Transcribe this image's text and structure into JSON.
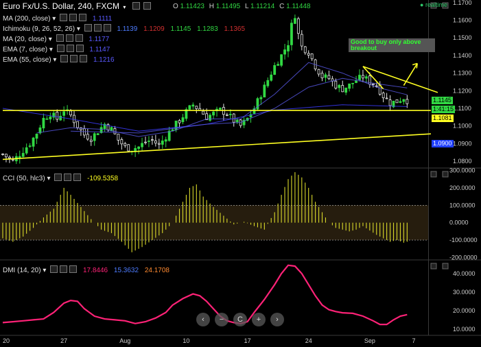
{
  "header": {
    "title": "Euro Fx/U.S. Dollar, 240, FXCM",
    "ohlc": [
      {
        "label": "O",
        "value": "1.11423"
      },
      {
        "label": "H",
        "value": "1.11495"
      },
      {
        "label": "L",
        "value": "1.11214"
      },
      {
        "label": "C",
        "value": "1.11448"
      }
    ],
    "realtime": "realtime"
  },
  "indicators": [
    {
      "name": "MA (200, close)",
      "values": [
        "1.1111"
      ],
      "colors": [
        "#5a5aff"
      ]
    },
    {
      "name": "Ichimoku (9, 26, 52, 26)",
      "values": [
        "1.1139",
        "1.1209",
        "1.1145",
        "1.1283",
        "1.1365"
      ],
      "colors": [
        "#4d7cff",
        "#d23030",
        "#31d843",
        "#31d843",
        "#d23030"
      ]
    },
    {
      "name": "MA (20, close)",
      "values": [
        "1.1177"
      ],
      "colors": [
        "#5a5aff"
      ]
    },
    {
      "name": "EMA (7, close)",
      "values": [
        "1.1147"
      ],
      "colors": [
        "#5a5aff"
      ]
    },
    {
      "name": "EMA (55, close)",
      "values": [
        "1.1216"
      ],
      "colors": [
        "#5a5aff"
      ]
    }
  ],
  "annotation": "Good to buy only above breakout",
  "price_labels": [
    {
      "text": "1.1145",
      "bg": "#31d843",
      "fg": "#000"
    },
    {
      "text": "1:41:15",
      "bg": "#31d843",
      "fg": "#000"
    },
    {
      "text": "1.1081",
      "bg": "#ffff22",
      "fg": "#000"
    },
    {
      "text": "1.0900",
      "bg": "#2040ff",
      "fg": "#fff"
    }
  ],
  "cci_panel": {
    "name": "CCI (50, hlc3)",
    "value": "-109.5358",
    "value_color": "#ffff22"
  },
  "dmi_panel": {
    "name": "DMI (14, 20)",
    "values": [
      "17.8446",
      "15.3632",
      "24.1708"
    ],
    "colors": [
      "#ff2277",
      "#4d7cff",
      "#ff8a30"
    ]
  },
  "controls": [
    "‹",
    "−",
    "C",
    "+",
    "›"
  ],
  "colors": {
    "bull": "#31d843",
    "bear": "#e8e8e8",
    "trend": "#ffff22",
    "ma": "#4a4aff",
    "cci": "#d9d92a",
    "dmi": "#ff2277"
  },
  "chart_data": [
    {
      "type": "candlestick",
      "title": "Euro Fx/U.S. Dollar, 240, FXCM",
      "x_ticks": [
        "20",
        "27",
        "Aug",
        "10",
        "17",
        "24",
        "Sep",
        "7"
      ],
      "y_ticks": [
        "1.1700",
        "1.1600",
        "1.1500",
        "1.1400",
        "1.1300",
        "1.1200",
        "1.1100",
        "1.1000",
        "1.0900",
        "1.0800"
      ],
      "ylim": [
        1.0765,
        1.1715
      ],
      "close_path": [
        [
          0,
          1.084
        ],
        [
          3,
          1.08
        ],
        [
          6,
          1.086
        ],
        [
          8,
          1.09
        ],
        [
          10,
          1.096
        ],
        [
          12,
          1.104
        ],
        [
          14,
          1.107
        ],
        [
          16,
          1.104
        ],
        [
          18,
          1.109
        ],
        [
          20,
          1.106
        ],
        [
          22,
          1.1
        ],
        [
          24,
          1.095
        ],
        [
          26,
          1.093
        ],
        [
          28,
          1.097
        ],
        [
          30,
          1.101
        ],
        [
          32,
          1.098
        ],
        [
          34,
          1.092
        ],
        [
          36,
          1.088
        ],
        [
          38,
          1.087
        ],
        [
          40,
          1.088
        ],
        [
          42,
          1.091
        ],
        [
          44,
          1.092
        ],
        [
          46,
          1.089
        ],
        [
          48,
          1.094
        ],
        [
          50,
          1.099
        ],
        [
          52,
          1.103
        ],
        [
          54,
          1.108
        ],
        [
          56,
          1.112
        ],
        [
          58,
          1.109
        ],
        [
          60,
          1.105
        ],
        [
          62,
          1.107
        ],
        [
          64,
          1.109
        ],
        [
          66,
          1.107
        ],
        [
          68,
          1.103
        ],
        [
          70,
          1.1
        ],
        [
          72,
          1.104
        ],
        [
          74,
          1.11
        ],
        [
          76,
          1.118
        ],
        [
          78,
          1.126
        ],
        [
          80,
          1.134
        ],
        [
          82,
          1.14
        ],
        [
          84,
          1.147
        ],
        [
          85,
          1.157
        ],
        [
          86,
          1.163
        ],
        [
          87,
          1.152
        ],
        [
          88,
          1.145
        ],
        [
          90,
          1.142
        ],
        [
          92,
          1.134
        ],
        [
          94,
          1.128
        ],
        [
          96,
          1.127
        ],
        [
          98,
          1.123
        ],
        [
          100,
          1.121
        ],
        [
          102,
          1.123
        ],
        [
          104,
          1.126
        ],
        [
          106,
          1.128
        ],
        [
          108,
          1.125
        ],
        [
          110,
          1.123
        ],
        [
          112,
          1.117
        ],
        [
          114,
          1.113
        ],
        [
          116,
          1.114
        ],
        [
          118,
          1.116
        ],
        [
          119,
          1.1145
        ]
      ],
      "series": [
        {
          "name": "MA (200, close)",
          "values": [
            [
              0,
              1.11
            ],
            [
              20,
              1.104
            ],
            [
              40,
              1.097
            ],
            [
              60,
              1.101
            ],
            [
              80,
              1.109
            ],
            [
              100,
              1.112
            ],
            [
              119,
              1.111
            ]
          ]
        },
        {
          "name": "MA (20, close)",
          "values": [
            [
              10,
              1.096
            ],
            [
              20,
              1.099
            ],
            [
              30,
              1.098
            ],
            [
              40,
              1.094
            ],
            [
              50,
              1.097
            ],
            [
              60,
              1.104
            ],
            [
              70,
              1.104
            ],
            [
              80,
              1.118
            ],
            [
              90,
              1.136
            ],
            [
              100,
              1.13
            ],
            [
              110,
              1.122
            ],
            [
              119,
              1.1177
            ]
          ]
        },
        {
          "name": "EMA (55, close)",
          "values": [
            [
              20,
              1.097
            ],
            [
              40,
              1.096
            ],
            [
              60,
              1.101
            ],
            [
              70,
              1.102
            ],
            [
              80,
              1.11
            ],
            [
              90,
              1.122
            ],
            [
              100,
              1.127
            ],
            [
              110,
              1.124
            ],
            [
              119,
              1.1216
            ]
          ]
        }
      ],
      "trendlines": [
        {
          "from": [
            0,
            1.081
          ],
          "to": [
            126,
            1.0955
          ]
        },
        {
          "from": [
            0,
            1.1088
          ],
          "to": [
            126,
            1.1088
          ]
        },
        {
          "from": [
            106,
            1.1338
          ],
          "to": [
            128,
            1.119
          ]
        },
        {
          "from": [
            106,
            1.1338
          ],
          "to": [
            112,
            1.121
          ]
        }
      ],
      "arrow": {
        "from": [
          118,
          1.123
        ],
        "to": [
          122,
          1.1355
        ]
      }
    },
    {
      "type": "bar",
      "title": "CCI (50, hlc3)",
      "y_ticks": [
        "300.0000",
        "200.0000",
        "100.0000",
        "0.0000",
        "-100.0000",
        "-200.0000"
      ],
      "ylim": [
        -210,
        310
      ],
      "bands": [
        100,
        -100
      ],
      "path": [
        [
          0,
          -90
        ],
        [
          3,
          -110
        ],
        [
          6,
          -80
        ],
        [
          9,
          -30
        ],
        [
          12,
          30
        ],
        [
          15,
          80
        ],
        [
          18,
          200
        ],
        [
          20,
          160
        ],
        [
          23,
          90
        ],
        [
          26,
          20
        ],
        [
          29,
          -40
        ],
        [
          32,
          -60
        ],
        [
          35,
          -110
        ],
        [
          38,
          -170
        ],
        [
          41,
          -140
        ],
        [
          44,
          -100
        ],
        [
          47,
          -60
        ],
        [
          50,
          0
        ],
        [
          53,
          120
        ],
        [
          55,
          200
        ],
        [
          57,
          220
        ],
        [
          59,
          150
        ],
        [
          62,
          90
        ],
        [
          65,
          40
        ],
        [
          68,
          -10
        ],
        [
          71,
          5
        ],
        [
          74,
          -20
        ],
        [
          77,
          -40
        ],
        [
          80,
          60
        ],
        [
          82,
          160
        ],
        [
          84,
          250
        ],
        [
          86,
          290
        ],
        [
          88,
          260
        ],
        [
          90,
          200
        ],
        [
          92,
          120
        ],
        [
          94,
          60
        ],
        [
          96,
          0
        ],
        [
          98,
          -30
        ],
        [
          100,
          -40
        ],
        [
          102,
          -50
        ],
        [
          104,
          -40
        ],
        [
          106,
          -20
        ],
        [
          108,
          -45
        ],
        [
          110,
          -70
        ],
        [
          112,
          -90
        ],
        [
          114,
          -110
        ],
        [
          116,
          -100
        ],
        [
          118,
          -115
        ],
        [
          119,
          -109.5
        ]
      ]
    },
    {
      "type": "line",
      "title": "DMI (14, 20)",
      "y_ticks": [
        "40.0000",
        "30.0000",
        "20.0000",
        "10.0000"
      ],
      "ylim": [
        7,
        47
      ],
      "series": [
        {
          "name": "DMI (14, 20)",
          "values": [
            [
              0,
              13.5
            ],
            [
              3,
              14
            ],
            [
              6,
              14.5
            ],
            [
              9,
              15
            ],
            [
              12,
              15.5
            ],
            [
              15,
              19
            ],
            [
              18,
              24
            ],
            [
              20,
              25.5
            ],
            [
              22,
              25
            ],
            [
              24,
              21
            ],
            [
              27,
              17
            ],
            [
              30,
              15.5
            ],
            [
              33,
              15
            ],
            [
              36,
              14.5
            ],
            [
              39,
              13
            ],
            [
              42,
              14
            ],
            [
              45,
              16
            ],
            [
              48,
              19
            ],
            [
              50,
              23
            ],
            [
              53,
              26.5
            ],
            [
              56,
              29
            ],
            [
              58,
              28
            ],
            [
              60,
              25
            ],
            [
              62,
              21
            ],
            [
              64,
              17
            ],
            [
              66,
              14.5
            ],
            [
              68,
              13.5
            ],
            [
              70,
              13
            ],
            [
              72,
              14
            ],
            [
              74,
              19
            ],
            [
              77,
              26
            ],
            [
              80,
              34
            ],
            [
              82,
              40
            ],
            [
              84,
              44.5
            ],
            [
              86,
              44
            ],
            [
              88,
              40
            ],
            [
              90,
              34
            ],
            [
              92,
              28
            ],
            [
              94,
              23
            ],
            [
              96,
              20.5
            ],
            [
              98,
              19.5
            ],
            [
              100,
              18.8
            ],
            [
              103,
              18.5
            ],
            [
              106,
              17
            ],
            [
              109,
              14.5
            ],
            [
              111,
              12.5
            ],
            [
              113,
              12.5
            ],
            [
              115,
              15
            ],
            [
              117,
              17
            ],
            [
              119,
              17.8
            ]
          ]
        }
      ]
    }
  ]
}
